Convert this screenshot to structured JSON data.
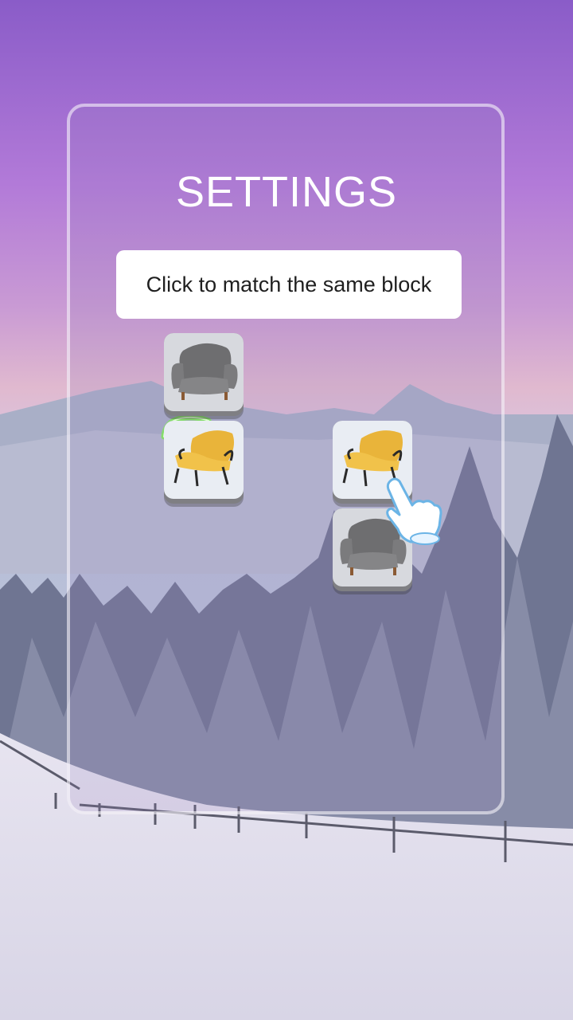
{
  "settings": {
    "title": "SETTINGS",
    "hint": "Click to match the same block"
  },
  "tiles": [
    {
      "icon": "gray-armchair-icon",
      "row": 0,
      "col": 0
    },
    {
      "icon": "yellow-armchair-icon",
      "row": 1,
      "col": 0,
      "highlighted": true
    },
    {
      "icon": "yellow-armchair-icon",
      "row": 1,
      "col": 2
    },
    {
      "icon": "gray-armchair-icon",
      "row": 2,
      "col": 2
    }
  ],
  "pointer": {
    "icon": "tap-hand-icon"
  },
  "colors": {
    "accent": "#7ee35b",
    "panel_border": "#ffffff",
    "tile_face": "#e9edf3"
  }
}
